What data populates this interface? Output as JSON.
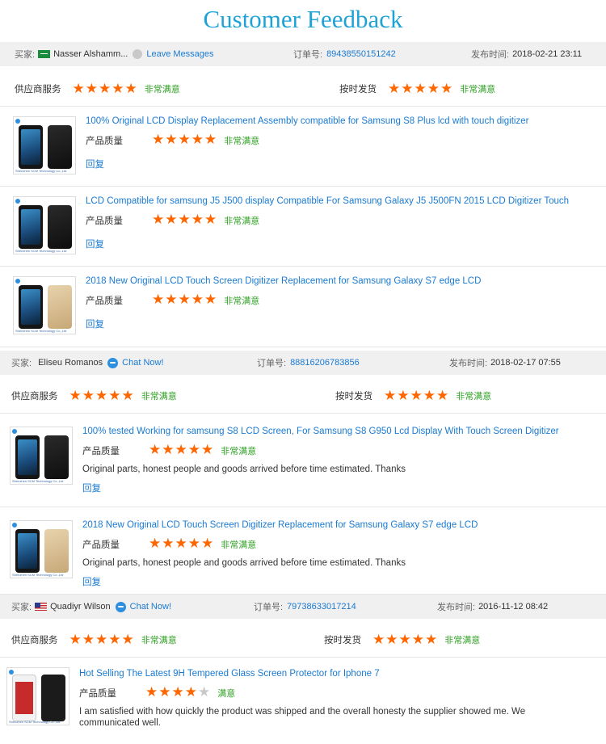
{
  "page_title": "Customer Feedback",
  "labels": {
    "buyer": "买家:",
    "order_no": "订单号:",
    "published": "发布时间:",
    "supplier_service": "供应商服务",
    "on_time_delivery": "按时发货",
    "product_quality": "产品质量",
    "reply": "回复"
  },
  "colors": {
    "accent": "#1fa3d6",
    "link": "#1a7ad1",
    "star": "#ff6600",
    "satisfied": "#31a026"
  },
  "feedback": [
    {
      "buyer_name": "Nasser Alshamm...",
      "flag": "saudi-arabia-flag",
      "contact_label": "Leave Messages",
      "order_number": "89438550151242",
      "published_time": "2018-02-21 23:11",
      "supplier_rating": 5,
      "supplier_rating_text": "非常满意",
      "delivery_rating": 5,
      "delivery_rating_text": "非常满意",
      "products": [
        {
          "title": "100% Original LCD Display Replacement Assembly compatible for Samsung S8 Plus lcd with touch digitizer",
          "rating": 5,
          "rating_text": "非常满意",
          "comment": ""
        },
        {
          "title": "LCD Compatible for samsung J5 J500 display Compatible For Samsung Galaxy J5 J500FN 2015 LCD Digitizer Touch",
          "rating": 5,
          "rating_text": "非常满意",
          "comment": ""
        },
        {
          "title": "2018 New Original LCD Touch Screen Digitizer Replacement for Samsung Galaxy S7 edge LCD",
          "rating": 5,
          "rating_text": "非常满意",
          "comment": ""
        }
      ]
    },
    {
      "buyer_name": "Eliseu Romanos",
      "flag": "",
      "contact_label": "Chat Now!",
      "order_number": "88816206783856",
      "published_time": "2018-02-17 07:55",
      "supplier_rating": 5,
      "supplier_rating_text": "非常满意",
      "delivery_rating": 5,
      "delivery_rating_text": "非常满意",
      "products": [
        {
          "title": "100% tested Working for samsung S8 LCD Screen, For Samsung S8 G950 Lcd Display With Touch Screen Digitizer",
          "rating": 5,
          "rating_text": "非常满意",
          "comment": "Original parts, honest people and goods arrived before time estimated. Thanks"
        },
        {
          "title": "2018 New Original LCD Touch Screen Digitizer Replacement for Samsung Galaxy S7 edge LCD",
          "rating": 5,
          "rating_text": "非常满意",
          "comment": "Original parts, honest people and goods arrived before time estimated. Thanks"
        }
      ]
    },
    {
      "buyer_name": "Quadiyr Wilson",
      "flag": "usa-flag",
      "contact_label": "Chat Now!",
      "order_number": "79738633017214",
      "published_time": "2016-11-12 08:42",
      "supplier_rating": 5,
      "supplier_rating_text": "非常满意",
      "delivery_rating": 5,
      "delivery_rating_text": "非常满意",
      "products": [
        {
          "title": "Hot Selling The Latest 9H Tempered Glass Screen Protector for Iphone 7",
          "rating": 4,
          "rating_text": "满意",
          "comment": "I am satisfied with how quickly the product was shipped and the overall honesty the supplier showed me. We communicated well."
        }
      ]
    }
  ],
  "thumb_caption": "Shenzhen SCM Technology Co.,Ltd"
}
